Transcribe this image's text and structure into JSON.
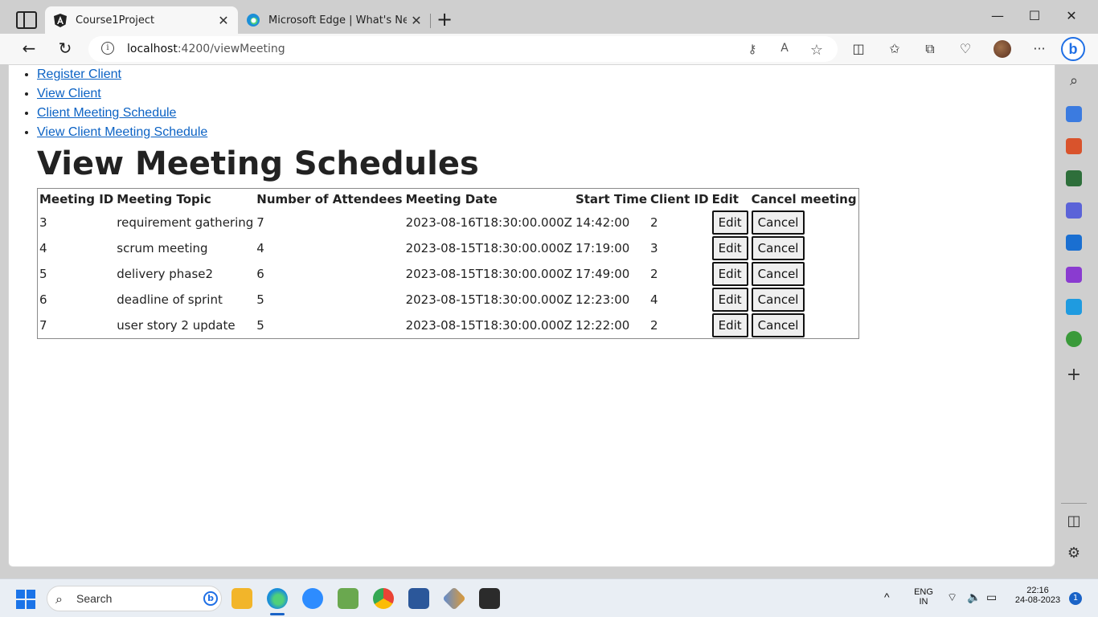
{
  "browser": {
    "tabs": [
      {
        "title": "Course1Project",
        "active": true,
        "icon": "angular-icon"
      },
      {
        "title": "Microsoft Edge | What's New",
        "active": false,
        "icon": "edge-icon"
      }
    ],
    "address": {
      "host": "localhost",
      "path": ":4200/viewMeeting"
    }
  },
  "nav": {
    "links": [
      "Register Client",
      "View Client",
      "Client Meeting Schedule",
      "View Client Meeting Schedule"
    ]
  },
  "page": {
    "title": "View Meeting Schedules"
  },
  "table": {
    "headers": [
      "Meeting ID",
      "Meeting Topic",
      "Number of Attendees",
      "Meeting Date",
      "Start Time",
      "Client ID",
      "Edit",
      "Cancel meeting"
    ],
    "rows": [
      {
        "id": "3",
        "topic": "requirement gathering",
        "attendees": "7",
        "date": "2023-08-16T18:30:00.000Z",
        "start": "14:42:00",
        "client": "2"
      },
      {
        "id": "4",
        "topic": "scrum meeting",
        "attendees": "4",
        "date": "2023-08-15T18:30:00.000Z",
        "start": "17:19:00",
        "client": "3"
      },
      {
        "id": "5",
        "topic": "delivery phase2",
        "attendees": "6",
        "date": "2023-08-15T18:30:00.000Z",
        "start": "17:49:00",
        "client": "2"
      },
      {
        "id": "6",
        "topic": "deadline of sprint",
        "attendees": "5",
        "date": "2023-08-15T18:30:00.000Z",
        "start": "12:23:00",
        "client": "4"
      },
      {
        "id": "7",
        "topic": "user story 2 update",
        "attendees": "5",
        "date": "2023-08-15T18:30:00.000Z",
        "start": "12:22:00",
        "client": "2"
      }
    ],
    "edit_label": "Edit",
    "cancel_label": "Cancel"
  },
  "taskbar": {
    "search_placeholder": "Search",
    "lang": "ENG",
    "region": "IN",
    "time": "22:16",
    "date": "24-08-2023",
    "notifications": "1"
  }
}
